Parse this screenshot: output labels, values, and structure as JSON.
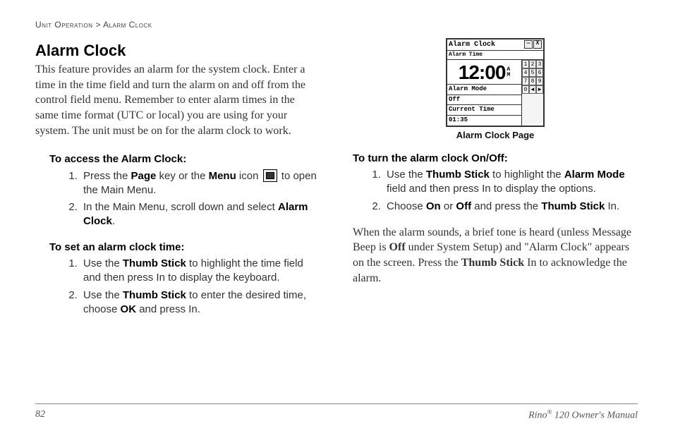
{
  "breadcrumb": {
    "section": "Unit Operation",
    "sep": ">",
    "page": "Alarm Clock"
  },
  "left": {
    "title": "Alarm Clock",
    "intro": "This feature provides an alarm for the system clock. Enter a time in the time field and turn the alarm on and off from the control field menu. Remember to enter alarm times in the same time format (UTC or local) you are using for your system. The unit must be on for the alarm clock to work.",
    "access": {
      "heading": "To access the Alarm Clock:",
      "step1_a": "Press the ",
      "step1_b": "Page",
      "step1_c": " key or the ",
      "step1_d": "Menu",
      "step1_e": " icon ",
      "step1_f": " to open the Main Menu.",
      "step2_a": "In the Main Menu, scroll down and select ",
      "step2_b": "Alarm Clock",
      "step2_c": "."
    },
    "set": {
      "heading": "To set an alarm clock time:",
      "step1_a": "Use the ",
      "step1_b": "Thumb Stick",
      "step1_c": " to highlight the time field and then press In to display the keyboard.",
      "step2_a": "Use the ",
      "step2_b": "Thumb Stick",
      "step2_c": " to enter the desired time, choose ",
      "step2_d": "OK",
      "step2_e": " and press In."
    }
  },
  "right": {
    "figure_caption": "Alarm Clock Page",
    "onoff": {
      "heading": "To turn the alarm clock On/Off:",
      "step1_a": "Use the ",
      "step1_b": "Thumb Stick",
      "step1_c": " to highlight the ",
      "step1_d": "Alarm Mode",
      "step1_e": " field and then press In to display the options.",
      "step2_a": "Choose ",
      "step2_b": "On",
      "step2_c": " or ",
      "step2_d": "Off",
      "step2_e": " and press the ",
      "step2_f": "Thumb Stick",
      "step2_g": " In."
    },
    "closing_a": "When the alarm sounds, a brief tone is heard (unless Message Beep is ",
    "closing_b": "Off",
    "closing_c": " under System Setup) and \"Alarm Clock\" appears on the screen. Press the ",
    "closing_d": "Thumb Stick",
    "closing_e": " In to acknowledge the alarm."
  },
  "device": {
    "title": "Alarm Clock",
    "alarm_time_label": "Alarm Time",
    "alarm_time_value": "12:00",
    "ampm_a": "A",
    "ampm_p": "M",
    "alarm_mode_label": "Alarm Mode",
    "alarm_mode_value": "Off",
    "current_time_label": "Current Time",
    "current_time_value": "01:35",
    "keys": [
      "1",
      "2",
      "3",
      "4",
      "5",
      "6",
      "7",
      "8",
      "9",
      "0",
      "◄",
      "►"
    ],
    "win_min": "—",
    "win_close": "X"
  },
  "footer": {
    "page_number": "82",
    "manual_a": "Rino",
    "manual_b": "®",
    "manual_c": " 120 Owner's Manual"
  }
}
